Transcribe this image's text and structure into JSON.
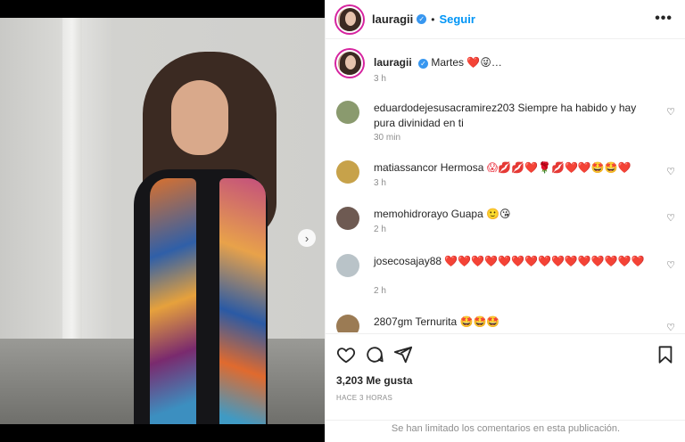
{
  "post": {
    "author": "lauragii",
    "follow_label": "Seguir",
    "caption_text": "Martes",
    "caption_emojis": "❤️😜…",
    "caption_time": "3 h",
    "likes": "3,203 Me gusta",
    "posted_ago": "HACE 3 HORAS",
    "comments_limited": "Se han limitado los comentarios en esta publicación."
  },
  "comments": [
    {
      "user": "eduardodejesusacramirez203",
      "text": "Siempre ha habido y hay pura divinidad en ti",
      "time": "30 min"
    },
    {
      "user": "matiassancor",
      "text": "Hermosa",
      "emojis": "😱💋💋❤️🌹💋❤️❤️🤩🤩❤️",
      "time": "3 h"
    },
    {
      "user": "memohidrorayo",
      "text": "Guapa",
      "emojis": "🙂😘",
      "time": "2 h"
    },
    {
      "user": "josecosajay88",
      "emojis": "❤️❤️❤️❤️❤️❤️❤️❤️❤️❤️❤️❤️❤️❤️❤️",
      "time": "2 h"
    },
    {
      "user": "2807gm",
      "text": "Ternurita",
      "emojis": "🤩🤩🤩"
    }
  ],
  "colors": {
    "follow": "#0095f6",
    "verified": "#3897f0",
    "muted": "#8e8e8e"
  },
  "icons": [
    "verified-badge-icon",
    "more-options-icon",
    "next-photo-icon",
    "like-icon",
    "comment-icon",
    "share-icon",
    "save-icon",
    "comment-like-icon"
  ]
}
